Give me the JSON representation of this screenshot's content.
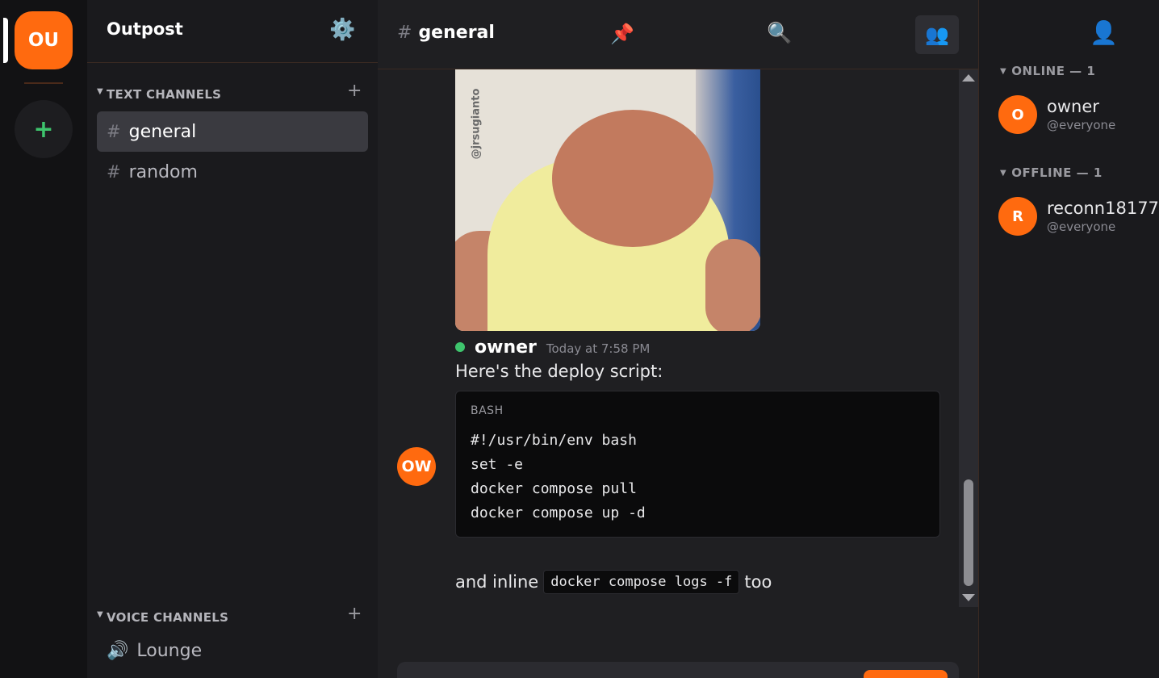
{
  "server_rail": {
    "current_server_initials": "OU",
    "add_server_label": "+"
  },
  "sidebar": {
    "server_name": "Outpost",
    "text_category": "TEXT CHANNELS",
    "voice_category": "VOICE CHANNELS",
    "add_label": "+",
    "text_channels": [
      {
        "label": "general",
        "active": true
      },
      {
        "label": "random",
        "active": false
      }
    ],
    "voice_channels": [
      {
        "label": "Lounge"
      }
    ]
  },
  "header": {
    "hash": "#",
    "channel_name": "general"
  },
  "attachment": {
    "watermark": "@jrsugianto"
  },
  "message": {
    "author": "owner",
    "author_initials": "OW",
    "timestamp": "Today at 7:58 PM",
    "text": "Here's the deploy script:",
    "code_language": "BASH",
    "code_lines": [
      "#!/usr/bin/env bash",
      "set -e",
      "docker compose pull",
      "docker compose up -d"
    ],
    "inline_before": "and inline",
    "inline_code": "docker compose logs -f",
    "inline_after": "too"
  },
  "members_panel": {
    "online_header": "ONLINE — 1",
    "offline_header": "OFFLINE — 1",
    "online": [
      {
        "initial": "O",
        "name": "owner",
        "role": "@everyone"
      }
    ],
    "offline": [
      {
        "initial": "R",
        "name": "reconn18177",
        "role": "@everyone"
      }
    ]
  },
  "colors": {
    "accent": "#ff6a0f",
    "online_status": "#3ec46d",
    "background": "#1f1f22"
  },
  "icons": [
    "gear-icon",
    "pin-icon",
    "search-icon",
    "members-icon",
    "profile-icon",
    "speaker-icon",
    "hash-icon"
  ]
}
